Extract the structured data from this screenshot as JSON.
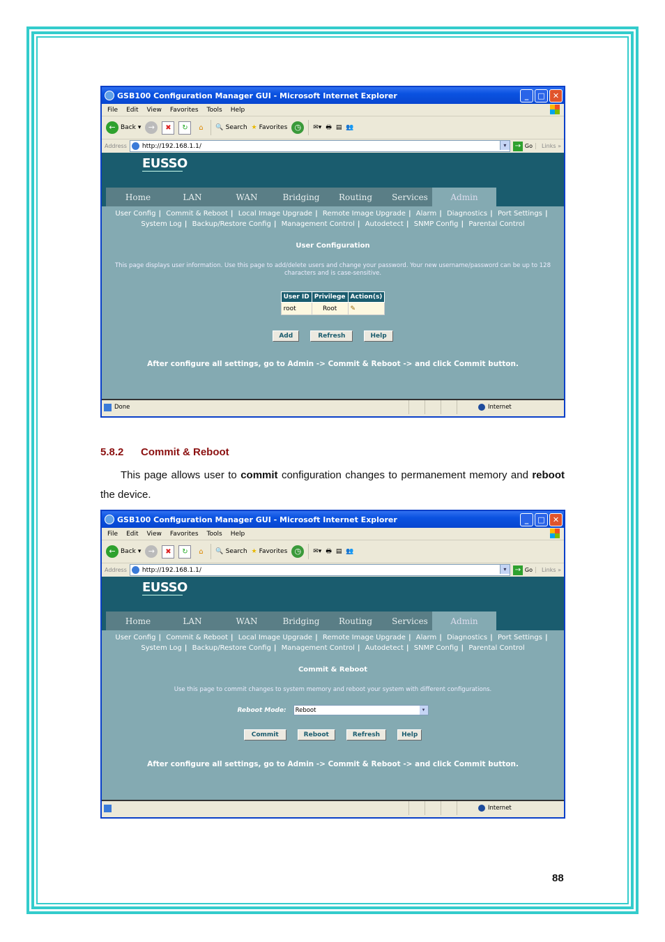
{
  "browser": {
    "title": "GSB100 Configuration Manager GUI - Microsoft Internet Explorer",
    "menu": [
      "File",
      "Edit",
      "View",
      "Favorites",
      "Tools",
      "Help"
    ],
    "toolbar": {
      "back": "Back",
      "search": "Search",
      "favorites": "Favorites"
    },
    "address_label": "Address",
    "address_value": "http://192.168.1.1/",
    "go": "Go",
    "links": "Links",
    "internet_zone": "Internet"
  },
  "router": {
    "logo": "EUSSO",
    "tabs": [
      "Home",
      "LAN",
      "WAN",
      "Bridging",
      "Routing",
      "Services",
      "Admin"
    ],
    "active_tab": "Admin",
    "subnav_row1": [
      "User Config",
      "Commit & Reboot",
      "Local Image Upgrade",
      "Remote Image Upgrade",
      "Alarm",
      "Diagnostics",
      "Port Settings"
    ],
    "subnav_row2": [
      "System Log",
      "Backup/Restore Config",
      "Management Control",
      "Autodetect",
      "SNMP Config",
      "Parental Control"
    ],
    "after_note": "After configure all settings, go to Admin -> Commit & Reboot -> and click Commit button."
  },
  "screen1": {
    "page_title": "User Configuration",
    "description": "This page displays user information. Use this page to add/delete users and change your password. Your new username/password can be up to 128 characters and is case-sensitive.",
    "table": {
      "headers": [
        "User ID",
        "Privilege",
        "Action(s)"
      ],
      "rows": [
        {
          "user_id": "root",
          "privilege": "Root",
          "action": "edit-icon"
        }
      ]
    },
    "buttons": [
      "Add",
      "Refresh",
      "Help"
    ],
    "status": "Done"
  },
  "document": {
    "section_number": "5.8.2",
    "section_title": "Commit & Reboot",
    "para_prefix": "This page allows user to ",
    "para_bold1": "commit",
    "para_middle": " configuration changes to permanement memory and ",
    "para_bold2": "reboot",
    "para_suffix": " the device.",
    "page_number": "88"
  },
  "screen2": {
    "page_title": "Commit & Reboot",
    "description": "Use this page to commit changes to system memory and reboot your system with different configurations.",
    "reboot_mode_label": "Reboot Mode:",
    "reboot_mode_value": "Reboot",
    "buttons": [
      "Commit",
      "Reboot",
      "Refresh",
      "Help"
    ],
    "status": ""
  }
}
